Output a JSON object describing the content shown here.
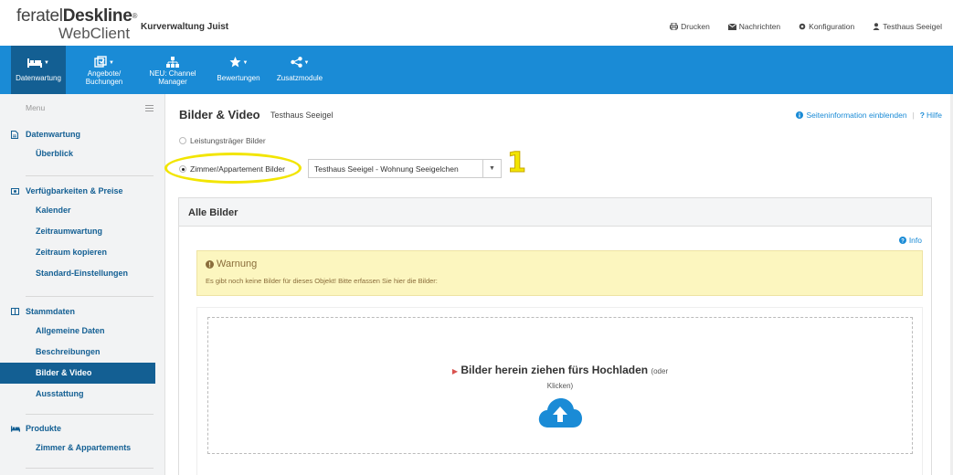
{
  "header": {
    "logo_line1_a": "feratel",
    "logo_line1_b": "Deskline",
    "logo_reg": "®",
    "logo_line2": "WebClient",
    "org_name": "Kurverwaltung Juist",
    "links": {
      "print": "Drucken",
      "messages": "Nachrichten",
      "config": "Konfiguration",
      "user": "Testhaus Seeigel"
    }
  },
  "nav": {
    "items": [
      {
        "label": "Datenwartung",
        "icon": "bed-icon"
      },
      {
        "label_1": "Angebote/",
        "label_2": "Buchungen",
        "icon": "offers-icon"
      },
      {
        "label_1": "NEU: Channel",
        "label_2": "Manager",
        "icon": "sitemap-icon"
      },
      {
        "label": "Bewertungen",
        "icon": "star-icon"
      },
      {
        "label": "Zusatzmodule",
        "icon": "share-icon"
      }
    ]
  },
  "sidebar": {
    "menu_label": "Menu",
    "groups": [
      {
        "title": "Datenwartung",
        "items": [
          "Überblick"
        ]
      },
      {
        "title": "Verfügbarkeiten & Preise",
        "items": [
          "Kalender",
          "Zeitraumwartung",
          "Zeitraum kopieren",
          "Standard-Einstellungen"
        ]
      },
      {
        "title": "Stammdaten",
        "items": [
          "Allgemeine Daten",
          "Beschreibungen",
          "Bilder & Video",
          "Ausstattung"
        ]
      },
      {
        "title": "Produkte",
        "items": [
          "Zimmer & Appartements"
        ]
      }
    ],
    "active_item": "Bilder & Video"
  },
  "main": {
    "title": "Bilder & Video",
    "subtitle": "Testhaus Seeigel",
    "show_info": "Seiteninformation einblenden",
    "separator": "|",
    "help": "Hilfe",
    "radio_1": "Leistungsträger Bilder",
    "radio_2": "Zimmer/Appartement Bilder",
    "select_value": "Testhaus Seeigel - Wohnung Seeigelchen",
    "annotation_number": "1",
    "panel_title": "Alle Bilder",
    "info_link": "Info",
    "warning_title": "Warnung",
    "warning_text": "Es gibt noch keine Bilder für dieses Objekt! Bitte erfassen Sie hier die Bilder:",
    "dropzone_title": "Bilder herein ziehen fürs Hochladen",
    "dropzone_title_small": "(oder",
    "dropzone_sub": "Klicken)"
  },
  "colors": {
    "nav_bg": "#1a8bd6",
    "nav_active": "#135f93",
    "annotation_yellow": "#f2e500",
    "warning_bg": "#fcf6bf"
  }
}
